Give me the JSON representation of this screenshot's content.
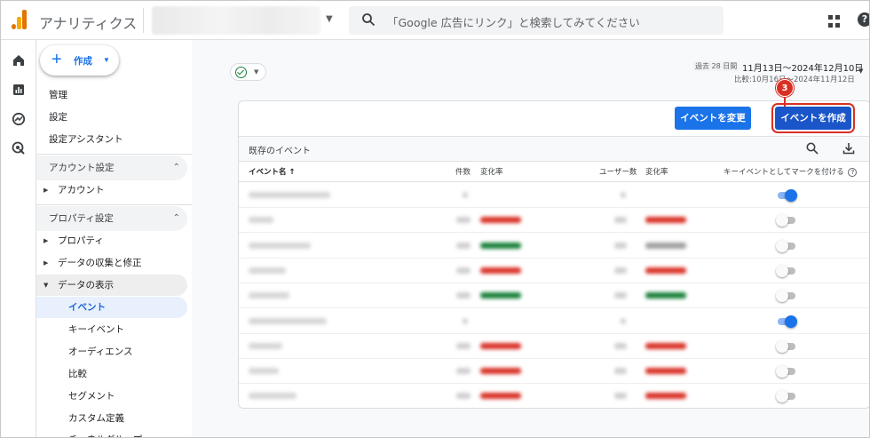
{
  "header": {
    "app_title": "アナリティクス",
    "search_placeholder": "「Google 広告にリンク」と検索してみてください",
    "help_glyph": "?"
  },
  "nav": {
    "create_label": "作成",
    "items_top": [
      "管理",
      "設定",
      "設定アシスタント"
    ],
    "account_section": "アカウント設定",
    "account_items": [
      "アカウント"
    ],
    "property_section": "プロパティ設定",
    "property_items": [
      "プロパティ",
      "データの収集と修正",
      "データの表示"
    ],
    "data_display_items": [
      "イベント",
      "キーイベント",
      "オーディエンス",
      "比較",
      "セグメント",
      "カスタム定義",
      "チャネルグループ"
    ]
  },
  "date_range": {
    "prefix": "過去 28 日間",
    "range": "11月13日～2024年12月10日",
    "compare": "比較:10月16日～2024年11月12日"
  },
  "card": {
    "modify_button": "イベントを変更",
    "create_button": "イベントを作成",
    "step_number": "3",
    "title": "既存のイベント",
    "columns": {
      "event_name": "イベント名 ↑",
      "count": "件数",
      "count_change": "変化率",
      "users": "ユーザー数",
      "users_change": "変化率",
      "mark_key_event": "キーイベントとしてマークを付ける"
    },
    "help_glyph": "?"
  },
  "rows": [
    {
      "key_event": true,
      "count_trend": "none",
      "users_trend": "none"
    },
    {
      "key_event": false,
      "count_trend": "down",
      "users_trend": "down"
    },
    {
      "key_event": false,
      "count_trend": "up",
      "users_trend": "flat"
    },
    {
      "key_event": false,
      "count_trend": "down",
      "users_trend": "down"
    },
    {
      "key_event": false,
      "count_trend": "up",
      "users_trend": "up"
    },
    {
      "key_event": true,
      "count_trend": "none",
      "users_trend": "none"
    },
    {
      "key_event": false,
      "count_trend": "down",
      "users_trend": "down"
    },
    {
      "key_event": false,
      "count_trend": "down",
      "users_trend": "down"
    },
    {
      "key_event": false,
      "count_trend": "down",
      "users_trend": "down"
    }
  ],
  "colors": {
    "brand_blue": "#1a73e8",
    "highlight_red": "#d93025",
    "positive_green": "#188038",
    "negative_red": "#d93025",
    "selected_nav_bg": "#e8f0fe"
  }
}
